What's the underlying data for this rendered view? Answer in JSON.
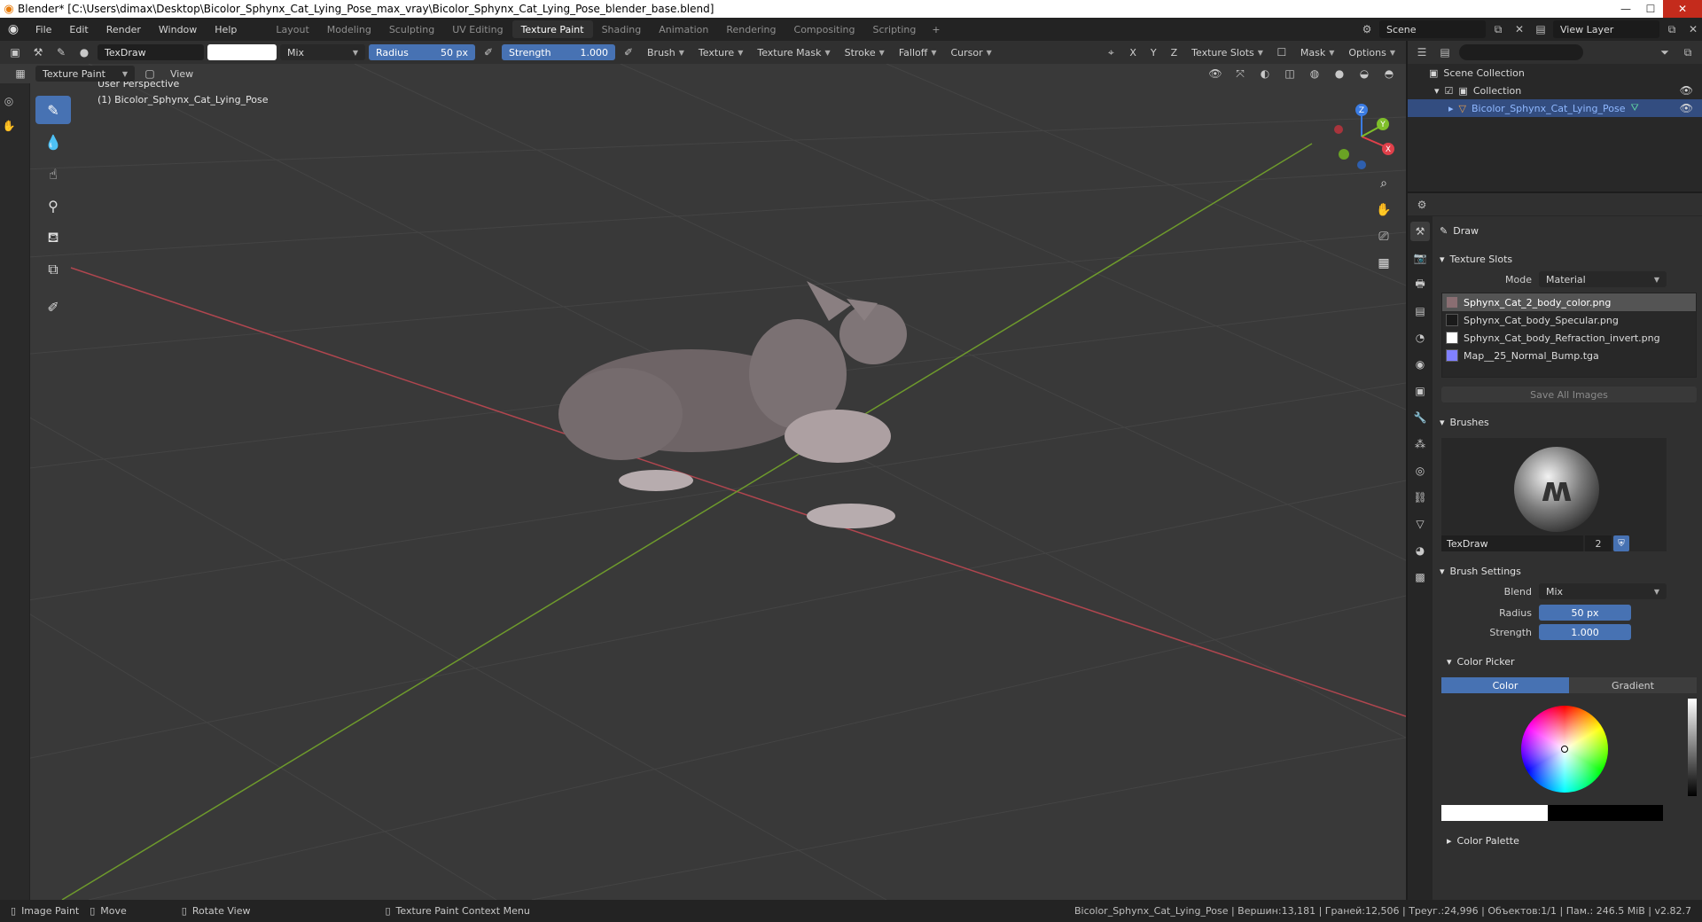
{
  "window": {
    "title": "Blender* [C:\\Users\\dimax\\Desktop\\Bicolor_Sphynx_Cat_Lying_Pose_max_vray\\Bicolor_Sphynx_Cat_Lying_Pose_blender_base.blend]",
    "controls": {
      "minimize": "—",
      "maximize": "☐",
      "close": "✕"
    }
  },
  "menu": [
    "File",
    "Edit",
    "Render",
    "Window",
    "Help"
  ],
  "workspaces": [
    "Layout",
    "Modeling",
    "Sculpting",
    "UV Editing",
    "Texture Paint",
    "Shading",
    "Animation",
    "Rendering",
    "Compositing",
    "Scripting"
  ],
  "active_workspace": "Texture Paint",
  "add_workspace": "+",
  "scene": {
    "name": "Scene",
    "view_layer": "View Layer"
  },
  "header": {
    "brush_name": "TexDraw",
    "blend": "Mix",
    "radius_label": "Radius",
    "radius_value": "50 px",
    "strength_label": "Strength",
    "strength_value": "1.000",
    "menus": [
      "Brush",
      "Texture",
      "Texture Mask",
      "Stroke",
      "Falloff",
      "Cursor"
    ],
    "axes": [
      "X",
      "Y",
      "Z"
    ],
    "texture_slots": "Texture Slots",
    "mask": "Mask",
    "options": "Options"
  },
  "subheader": {
    "mode": "Texture Paint",
    "view": "View"
  },
  "viewport": {
    "perspective": "User Perspective",
    "object_label": "(1) Bicolor_Sphynx_Cat_Lying_Pose",
    "gizmo": {
      "x": "X",
      "y": "Y",
      "z": "Z"
    },
    "colors": {
      "x_axis": "#b0464f",
      "y_axis": "#6e9a2c",
      "grid": "#444444",
      "background": "#393939"
    }
  },
  "outliner": {
    "search_placeholder": "",
    "rows": [
      {
        "label": "Scene Collection"
      },
      {
        "label": "Collection"
      },
      {
        "label": "Bicolor_Sphynx_Cat_Lying_Pose"
      }
    ]
  },
  "properties": {
    "tool_name": "Draw",
    "texture_slots": {
      "title": "Texture Slots",
      "mode_label": "Mode",
      "mode_value": "Material",
      "items": [
        {
          "name": "Sphynx_Cat_2_body_color.png",
          "color": "#8a6e72"
        },
        {
          "name": "Sphynx_Cat_body_Specular.png",
          "color": "#1a1a1a"
        },
        {
          "name": "Sphynx_Cat_body_Refraction_invert.png",
          "color": "#ffffff"
        },
        {
          "name": "Map__25_Normal_Bump.tga",
          "color": "#8080ff"
        }
      ],
      "save_all": "Save All Images"
    },
    "brushes": {
      "title": "Brushes",
      "name": "TexDraw",
      "users": "2"
    },
    "brush_settings": {
      "title": "Brush Settings",
      "blend_label": "Blend",
      "blend_value": "Mix",
      "radius_label": "Radius",
      "radius_value": "50 px",
      "strength_label": "Strength",
      "strength_value": "1.000"
    },
    "color_picker": {
      "title": "Color Picker",
      "color_tab": "Color",
      "gradient_tab": "Gradient"
    },
    "color_palette": "Color Palette"
  },
  "statusbar": {
    "items": [
      "Image Paint",
      "Move",
      "Rotate View",
      "Texture Paint Context Menu"
    ],
    "stats": "Bicolor_Sphynx_Cat_Lying_Pose | Вершин:13,181 | Граней:12,506 | Треуг.:24,996 | Объектов:1/1 | Пам.: 246.5 MiB | v2.82.7"
  }
}
